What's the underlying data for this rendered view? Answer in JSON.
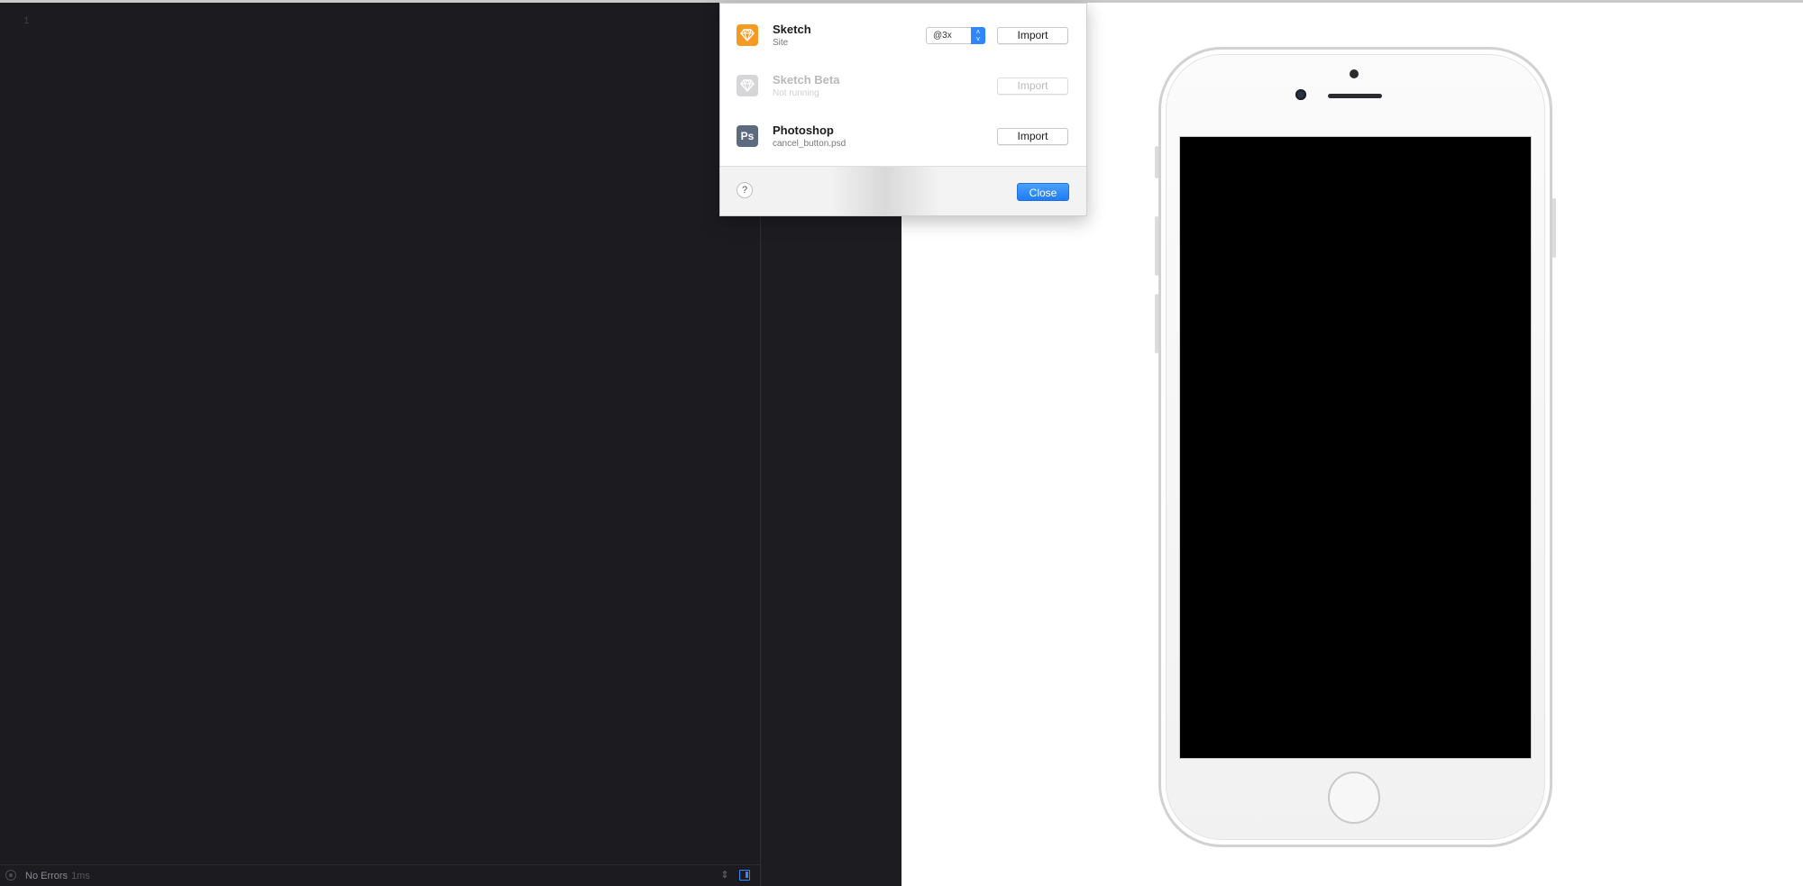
{
  "editor": {
    "line_number": "1",
    "status_text": "No Errors",
    "status_time": "1ms"
  },
  "dialog": {
    "apps": [
      {
        "name": "Sketch",
        "subtitle": "Site",
        "icon": "sketch-icon",
        "import_label": "Import",
        "scale": "@3x",
        "enabled": true
      },
      {
        "name": "Sketch Beta",
        "subtitle": "Not running",
        "icon": "sketch-beta-icon",
        "import_label": "Import",
        "enabled": false
      },
      {
        "name": "Photoshop",
        "subtitle": "cancel_button.psd",
        "icon": "photoshop-icon",
        "icon_text": "Ps",
        "import_label": "Import",
        "enabled": true
      }
    ],
    "help_label": "?",
    "close_label": "Close"
  },
  "colors": {
    "editor_bg": "#1c1c20",
    "accent": "#2f86ff",
    "sketch_orange": "#f59a23",
    "photoshop_slate": "#5c6b7e"
  }
}
